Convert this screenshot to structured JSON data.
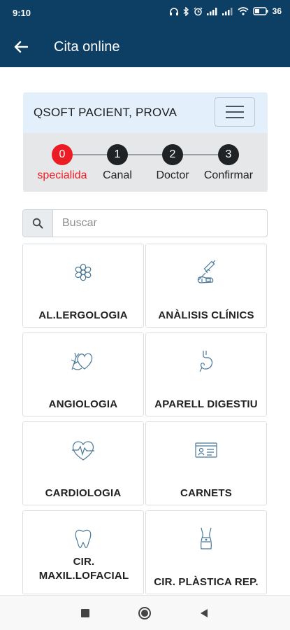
{
  "status_bar": {
    "time": "9:10",
    "battery": "36"
  },
  "app_bar": {
    "title": "Cita online"
  },
  "patient": {
    "name": "QSOFT PACIENT, PROVA"
  },
  "steps": [
    {
      "number": "0",
      "label": "specialida",
      "active": true
    },
    {
      "number": "1",
      "label": "Canal",
      "active": false
    },
    {
      "number": "2",
      "label": "Doctor",
      "active": false
    },
    {
      "number": "3",
      "label": "Confirmar",
      "active": false
    }
  ],
  "search": {
    "placeholder": "Buscar",
    "value": ""
  },
  "specialties": [
    {
      "label": "AL.LERGOLOGIA",
      "icon": "allergy-icon"
    },
    {
      "label": "ANÀLISIS CLÍNICS",
      "icon": "syringe-icon"
    },
    {
      "label": "ANGIOLOGIA",
      "icon": "heart-vessels-icon"
    },
    {
      "label": "APARELL DIGESTIU",
      "icon": "stomach-icon"
    },
    {
      "label": "CARDIOLOGIA",
      "icon": "heartbeat-icon"
    },
    {
      "label": "CARNETS",
      "icon": "id-card-icon"
    },
    {
      "label": "CIR. MAXIL.LOFACIAL",
      "icon": "tooth-icon"
    },
    {
      "label": "CIR. PLÀSTICA REP.",
      "icon": "body-icon"
    }
  ],
  "colors": {
    "primary": "#0d3e63",
    "active_step": "#ec1c24",
    "icon": "#4a7896",
    "patient_header": "#e3f0fb",
    "steps_bg": "#e6e7e8"
  }
}
